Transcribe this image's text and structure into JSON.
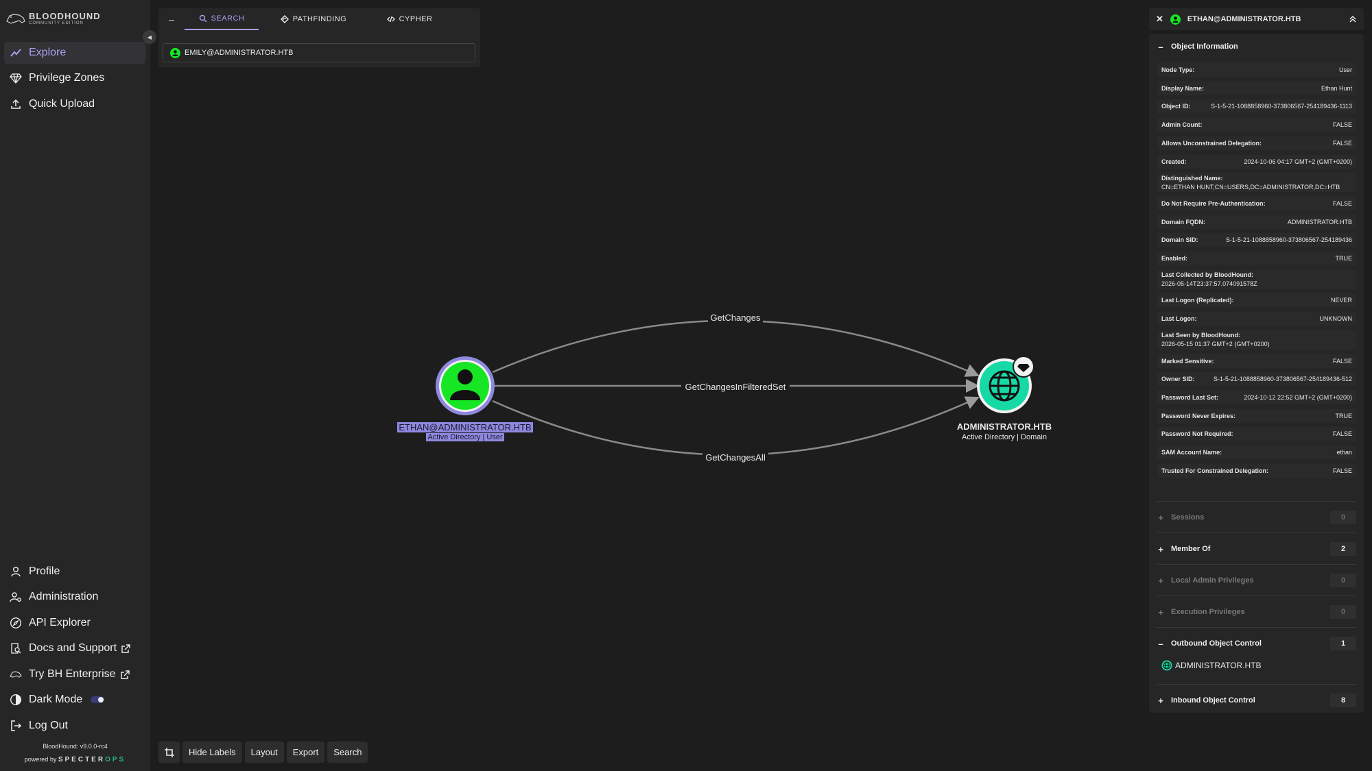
{
  "app": {
    "logo_line1": "BLOODHOUND",
    "logo_line2": "COMMUNITY EDITION",
    "version": "BloodHound: v9.0.0-rc4",
    "powered_by": "powered by",
    "powered_brand": "SPECTER",
    "powered_brand2": "OPS"
  },
  "sidebar": {
    "top_items": [
      {
        "label": "Explore",
        "icon": "chart-line-icon",
        "active": true
      },
      {
        "label": "Privilege Zones",
        "icon": "gem-icon"
      },
      {
        "label": "Quick Upload",
        "icon": "upload-icon"
      }
    ],
    "bottom_items": [
      {
        "label": "Profile",
        "icon": "user-icon"
      },
      {
        "label": "Administration",
        "icon": "user-gear-icon"
      },
      {
        "label": "API Explorer",
        "icon": "compass-icon"
      },
      {
        "label": "Docs and Support",
        "icon": "book-search-icon",
        "external": true
      },
      {
        "label": "Try BH Enterprise",
        "icon": "bloodhound-icon",
        "external": true
      },
      {
        "label": "Dark Mode",
        "icon": "contrast-icon",
        "toggle": true
      },
      {
        "label": "Log Out",
        "icon": "logout-icon"
      }
    ]
  },
  "search_panel": {
    "minimize": "–",
    "tabs": [
      {
        "label": "SEARCH",
        "active": true
      },
      {
        "label": "PATHFINDING"
      },
      {
        "label": "CYPHER"
      }
    ],
    "query": "EMILY@ADMINISTRATOR.HTB"
  },
  "graph": {
    "nodes": [
      {
        "name": "ETHAN@ADMINISTRATOR.HTB",
        "subtitle": "Active Directory | User",
        "type": "user"
      },
      {
        "name": "ADMINISTRATOR.HTB",
        "subtitle": "Active Directory | Domain",
        "type": "domain"
      }
    ],
    "edges": [
      {
        "label": "GetChanges"
      },
      {
        "label": "GetChangesInFilteredSet"
      },
      {
        "label": "GetChangesAll"
      }
    ]
  },
  "toolbar": {
    "crop_icon": "crop-icon",
    "buttons": [
      "Hide Labels",
      "Layout",
      "Export",
      "Search"
    ]
  },
  "colors": {
    "accent": "#a89ff0",
    "user_node": "#17e625",
    "domain_node": "#17d9a6",
    "background": "#1d1d1d",
    "panel": "#262626"
  },
  "entity_panel": {
    "title": "ETHAN@ADMINISTRATOR.HTB",
    "object_info_label": "Object Information",
    "properties": [
      {
        "key": "Node Type:",
        "value": "User"
      },
      {
        "key": "Display Name:",
        "value": "Ethan Hunt"
      },
      {
        "key": "Object ID:",
        "value": "S-1-5-21-1088858960-373806567-254189436-1113"
      },
      {
        "key": "Admin Count:",
        "value": "FALSE"
      },
      {
        "key": "Allows Unconstrained Delegation:",
        "value": "FALSE"
      },
      {
        "key": "Created:",
        "value": "2024-10-06 04:17 GMT+2 (GMT+0200)"
      },
      {
        "key": "Distinguished Name:",
        "value": "CN=ETHAN HUNT,CN=USERS,DC=ADMINISTRATOR,DC=HTB",
        "stacked": true
      },
      {
        "key": "Do Not Require Pre-Authentication:",
        "value": "FALSE"
      },
      {
        "key": "Domain FQDN:",
        "value": "ADMINISTRATOR.HTB"
      },
      {
        "key": "Domain SID:",
        "value": "S-1-5-21-1088858960-373806567-254189436"
      },
      {
        "key": "Enabled:",
        "value": "TRUE"
      },
      {
        "key": "Last Collected by BloodHound:",
        "value": "2026-05-14T23:37:57.074091578Z",
        "stacked": true
      },
      {
        "key": "Last Logon (Replicated):",
        "value": "NEVER"
      },
      {
        "key": "Last Logon:",
        "value": "UNKNOWN"
      },
      {
        "key": "Last Seen by BloodHound:",
        "value": "2026-05-15 01:37 GMT+2 (GMT+0200)",
        "stacked": true
      },
      {
        "key": "Marked Sensitive:",
        "value": "FALSE"
      },
      {
        "key": "Owner SID:",
        "value": "S-1-5-21-1088858960-373806567-254189436-512"
      },
      {
        "key": "Password Last Set:",
        "value": "2024-10-12 22:52 GMT+2 (GMT+0200)"
      },
      {
        "key": "Password Never Expires:",
        "value": "TRUE"
      },
      {
        "key": "Password Not Required:",
        "value": "FALSE"
      },
      {
        "key": "SAM Account Name:",
        "value": "ethan"
      },
      {
        "key": "Trusted For Constrained Delegation:",
        "value": "FALSE"
      }
    ],
    "sections": [
      {
        "label": "Sessions",
        "count": "0",
        "dim": true,
        "sign": "+"
      },
      {
        "label": "Member Of",
        "count": "2",
        "sign": "+"
      },
      {
        "label": "Local Admin Privileges",
        "count": "0",
        "dim": true,
        "sign": "+"
      },
      {
        "label": "Execution Privileges",
        "count": "0",
        "dim": true,
        "sign": "+"
      },
      {
        "label": "Outbound Object Control",
        "count": "1",
        "sign": "–"
      },
      {
        "label": "Inbound Object Control",
        "count": "8",
        "sign": "+"
      }
    ],
    "outbound_item": "ADMINISTRATOR.HTB"
  }
}
